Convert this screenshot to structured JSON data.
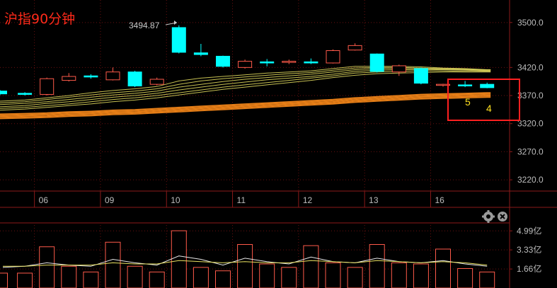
{
  "title": "沪指90分钟",
  "colors": {
    "up": "#ff5a4a",
    "down": "#00ffff",
    "ma_yellow": "#e8e060",
    "ma_orange": "#ff8c1a",
    "highlight_box": "#ff2020"
  },
  "icons": [
    "gear-icon",
    "close-icon"
  ],
  "annotations": {
    "high_label": "3494.87",
    "box_label_left": "5",
    "box_label_right": "4"
  },
  "chart_data": [
    {
      "type": "candlestick",
      "panel": "price",
      "title": "沪指90分钟",
      "ylim": [
        3200,
        3530
      ],
      "yticks": [
        {
          "value": 3500,
          "label": "3500.0"
        },
        {
          "value": 3420,
          "label": "3420.0"
        },
        {
          "value": 3370,
          "label": "3370.0"
        },
        {
          "value": 3320,
          "label": "3320.0"
        },
        {
          "value": 3270,
          "label": "3270.0"
        },
        {
          "value": 3220,
          "label": "3220.0"
        }
      ],
      "xticks": [
        {
          "index": 2,
          "label": "06"
        },
        {
          "index": 5,
          "label": "09"
        },
        {
          "index": 8,
          "label": "10"
        },
        {
          "index": 11,
          "label": "11"
        },
        {
          "index": 14,
          "label": "12"
        },
        {
          "index": 17,
          "label": "13"
        },
        {
          "index": 20,
          "label": "16"
        }
      ],
      "candles": [
        {
          "o": 3378,
          "h": 3380,
          "l": 3371,
          "c": 3373
        },
        {
          "o": 3374,
          "h": 3376,
          "l": 3370,
          "c": 3372
        },
        {
          "o": 3372,
          "h": 3402,
          "l": 3370,
          "c": 3400
        },
        {
          "o": 3397,
          "h": 3410,
          "l": 3395,
          "c": 3404
        },
        {
          "o": 3405,
          "h": 3408,
          "l": 3400,
          "c": 3403
        },
        {
          "o": 3398,
          "h": 3420,
          "l": 3397,
          "c": 3412
        },
        {
          "o": 3412,
          "h": 3414,
          "l": 3385,
          "c": 3387
        },
        {
          "o": 3390,
          "h": 3402,
          "l": 3388,
          "c": 3399
        },
        {
          "o": 3491,
          "h": 3495,
          "l": 3445,
          "c": 3447
        },
        {
          "o": 3446,
          "h": 3462,
          "l": 3440,
          "c": 3443
        },
        {
          "o": 3440,
          "h": 3441,
          "l": 3420,
          "c": 3422
        },
        {
          "o": 3420,
          "h": 3434,
          "l": 3418,
          "c": 3431
        },
        {
          "o": 3430,
          "h": 3435,
          "l": 3422,
          "c": 3428
        },
        {
          "o": 3429,
          "h": 3434,
          "l": 3426,
          "c": 3431
        },
        {
          "o": 3430,
          "h": 3436,
          "l": 3426,
          "c": 3428
        },
        {
          "o": 3428,
          "h": 3452,
          "l": 3427,
          "c": 3450
        },
        {
          "o": 3451,
          "h": 3463,
          "l": 3450,
          "c": 3459
        },
        {
          "o": 3444,
          "h": 3445,
          "l": 3411,
          "c": 3413
        },
        {
          "o": 3412,
          "h": 3425,
          "l": 3405,
          "c": 3423
        },
        {
          "o": 3418,
          "h": 3420,
          "l": 3390,
          "c": 3392
        },
        {
          "o": 3389,
          "h": 3391,
          "l": 3386,
          "c": 3390
        },
        {
          "o": 3389,
          "h": 3396,
          "l": 3385,
          "c": 3388
        },
        {
          "o": 3390,
          "h": 3393,
          "l": 3383,
          "c": 3384
        }
      ],
      "moving_averages": [
        {
          "group": "yellow",
          "values": [
            3360,
            3362,
            3366,
            3370,
            3375,
            3379,
            3382,
            3386,
            3396,
            3401,
            3404,
            3407,
            3410,
            3412,
            3414,
            3418,
            3422,
            3422,
            3422,
            3421,
            3419,
            3418,
            3416
          ]
        },
        {
          "group": "yellow",
          "values": [
            3357,
            3359,
            3363,
            3367,
            3371,
            3375,
            3378,
            3382,
            3390,
            3396,
            3400,
            3403,
            3406,
            3409,
            3411,
            3415,
            3419,
            3420,
            3420,
            3419,
            3418,
            3417,
            3416
          ]
        },
        {
          "group": "yellow",
          "values": [
            3354,
            3356,
            3359,
            3363,
            3367,
            3371,
            3374,
            3378,
            3385,
            3390,
            3395,
            3399,
            3402,
            3405,
            3408,
            3412,
            3416,
            3418,
            3418,
            3418,
            3417,
            3416,
            3415
          ]
        },
        {
          "group": "yellow",
          "values": [
            3350,
            3352,
            3356,
            3359,
            3363,
            3367,
            3370,
            3374,
            3380,
            3385,
            3390,
            3394,
            3398,
            3401,
            3404,
            3408,
            3413,
            3415,
            3416,
            3416,
            3416,
            3415,
            3414
          ]
        },
        {
          "group": "yellow",
          "values": [
            3347,
            3349,
            3352,
            3355,
            3359,
            3363,
            3366,
            3370,
            3375,
            3380,
            3385,
            3389,
            3393,
            3397,
            3401,
            3405,
            3410,
            3412,
            3413,
            3414,
            3414,
            3413,
            3413
          ]
        },
        {
          "group": "yellow",
          "values": [
            3344,
            3346,
            3349,
            3352,
            3355,
            3359,
            3362,
            3366,
            3371,
            3376,
            3381,
            3385,
            3389,
            3393,
            3397,
            3402,
            3406,
            3409,
            3410,
            3411,
            3412,
            3412,
            3412
          ]
        },
        {
          "group": "orange",
          "values": [
            3337,
            3338,
            3339,
            3341,
            3342,
            3344,
            3345,
            3347,
            3349,
            3351,
            3353,
            3355,
            3357,
            3359,
            3361,
            3363,
            3366,
            3368,
            3370,
            3372,
            3373,
            3374,
            3375
          ]
        },
        {
          "group": "orange",
          "values": [
            3335,
            3336,
            3337,
            3339,
            3340,
            3342,
            3343,
            3345,
            3347,
            3349,
            3351,
            3353,
            3355,
            3357,
            3359,
            3361,
            3364,
            3366,
            3368,
            3370,
            3371,
            3372,
            3373
          ]
        },
        {
          "group": "orange",
          "values": [
            3333,
            3334,
            3335,
            3337,
            3338,
            3340,
            3341,
            3343,
            3345,
            3347,
            3349,
            3351,
            3353,
            3355,
            3357,
            3359,
            3362,
            3364,
            3366,
            3368,
            3369,
            3370,
            3371
          ]
        },
        {
          "group": "orange",
          "values": [
            3331,
            3332,
            3333,
            3335,
            3336,
            3338,
            3339,
            3341,
            3343,
            3345,
            3347,
            3349,
            3351,
            3353,
            3355,
            3357,
            3360,
            3362,
            3364,
            3366,
            3367,
            3368,
            3369
          ]
        },
        {
          "group": "orange",
          "values": [
            3329,
            3330,
            3331,
            3333,
            3334,
            3336,
            3337,
            3339,
            3341,
            3343,
            3345,
            3347,
            3349,
            3351,
            3353,
            3355,
            3358,
            3360,
            3362,
            3364,
            3365,
            3366,
            3367
          ]
        }
      ]
    },
    {
      "type": "bar",
      "panel": "volume",
      "unit": "亿",
      "ylim": [
        0,
        5.5
      ],
      "yticks": [
        {
          "value": 4.99,
          "label": "4.99亿"
        },
        {
          "value": 3.33,
          "label": "3.33亿"
        },
        {
          "value": 1.66,
          "label": "1.66亿"
        }
      ],
      "values": [
        1.3,
        1.3,
        3.6,
        1.9,
        1.4,
        4.0,
        1.9,
        1.4,
        5.0,
        1.8,
        1.5,
        3.8,
        2.1,
        1.8,
        3.7,
        2.2,
        1.8,
        3.8,
        2.2,
        2.1,
        3.4,
        1.7,
        1.4
      ],
      "directions": [
        "up",
        "up",
        "up",
        "up",
        "up",
        "up",
        "up",
        "up",
        "up",
        "up",
        "up",
        "up",
        "up",
        "up",
        "up",
        "up",
        "up",
        "up",
        "up",
        "up",
        "up",
        "up",
        "up"
      ],
      "lines": [
        {
          "color": "white",
          "values": [
            1.8,
            1.9,
            2.2,
            2.0,
            1.9,
            2.5,
            2.2,
            2.0,
            2.8,
            2.5,
            2.0,
            2.6,
            2.3,
            2.1,
            2.7,
            2.3,
            2.2,
            2.6,
            2.3,
            2.2,
            2.4,
            2.1,
            1.9
          ]
        },
        {
          "color": "yellow",
          "values": [
            1.9,
            1.9,
            2.0,
            2.0,
            2.0,
            2.2,
            2.1,
            2.1,
            2.4,
            2.3,
            2.2,
            2.3,
            2.2,
            2.2,
            2.4,
            2.3,
            2.2,
            2.4,
            2.3,
            2.2,
            2.3,
            2.2,
            2.0
          ]
        }
      ]
    }
  ]
}
